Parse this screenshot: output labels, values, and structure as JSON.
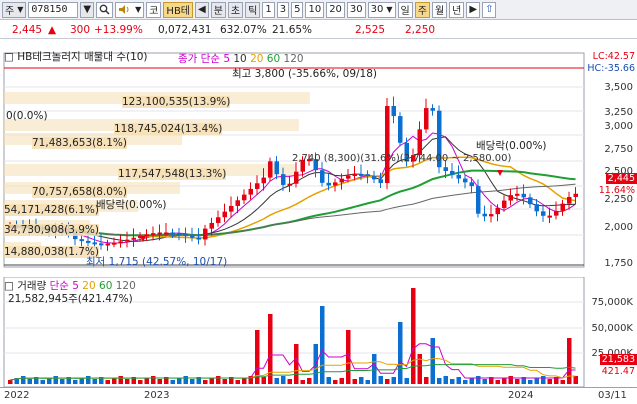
{
  "toolbar": {
    "market_label": "주",
    "code": "078150",
    "name_button": "HB테",
    "ko_button": "코",
    "view_buttons": [
      "분",
      "초",
      "틱"
    ],
    "period_numbers": [
      "1",
      "3",
      "5",
      "10",
      "20",
      "30"
    ],
    "period_select": "30",
    "day_button": "일",
    "week_button": "주",
    "month_button": "월",
    "year_button": "년",
    "arrow_left": "◀",
    "arrow_right": "▶"
  },
  "info": {
    "price": "2,445",
    "change_arrow": "▲",
    "change": "300",
    "change_pct": "+13.99%",
    "volume": "0,072,431",
    "volume_pct": "632.07%",
    "turnover": "21.65%",
    "high": "2,525",
    "low": "2,250"
  },
  "price_chart": {
    "title": "HB테크놀러지 매물대 수(10)",
    "legend_close": "종가 단순",
    "ma_labels": [
      "5",
      "10",
      "20",
      "60",
      "120"
    ],
    "lc_badge": "LC:42.57",
    "hc_badge": "HC:-35.66",
    "high_label": "최고 3,800 (-35.66%, 09/18)",
    "low_label": "최저 1,715 (42.57%, 10/17)",
    "dividend_labels": [
      "배당락(0.00%)",
      "배당락(0.00%)"
    ],
    "range_label": "2,740 (8,300)(31.6%)(2,744.00 ~ 2,580.00)",
    "price_badge": "2,445",
    "pct_badge": "11.64%",
    "volume_profile": [
      {
        "label": "123,100,535(13.9%)",
        "pct": 13.9
      },
      {
        "label": "0(0.0%)",
        "pct": 0.0
      },
      {
        "label": "118,745,024(13.4%)",
        "pct": 13.4
      },
      {
        "label": "71,483,653(8.1%)",
        "pct": 8.1
      },
      {
        "label": "117,547,548(13.3%)",
        "pct": 13.3
      },
      {
        "label": "70,757,658(8.0%)",
        "pct": 8.0
      },
      {
        "label": "54,171,428(6.1%)",
        "pct": 6.1
      },
      {
        "label": "34,730,908(3.9%)",
        "pct": 3.9
      },
      {
        "label": "14,880,038(1.7%)",
        "pct": 1.7
      }
    ],
    "y_ticks": [
      "3,500",
      "3,250",
      "3,000",
      "2,750",
      "2,500",
      "2,250",
      "2,000",
      "1,750"
    ]
  },
  "volume_chart": {
    "title": "거래량",
    "legend": "단순",
    "ma_labels": [
      "5",
      "20",
      "60",
      "120"
    ],
    "sub_label": "21,582,945주(421.47%)",
    "y_ticks": [
      "75,000K",
      "50,000K",
      "25,000K"
    ],
    "badge_value": "21,583",
    "badge_pct": "421.47"
  },
  "x_axis": {
    "labels": [
      "2022",
      "2023",
      "2024",
      "03/11"
    ]
  },
  "colors": {
    "up": "#e60012",
    "down": "#0b6fd1",
    "ma5": "#cc00cc",
    "ma10": "#333333",
    "ma20": "#e6a100",
    "ma60": "#1f9e35",
    "ma120": "#666666",
    "highlight": "#f5deb3"
  }
}
